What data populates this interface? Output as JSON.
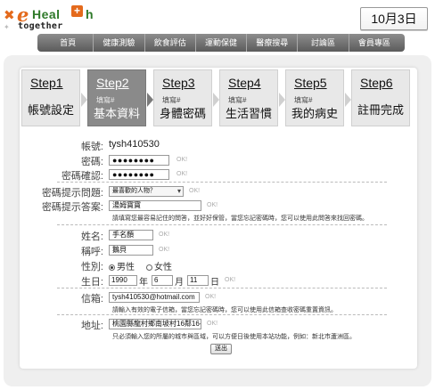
{
  "header": {
    "logo": {
      "e": "e",
      "heal": "Heal",
      "plus": "+",
      "h": "h",
      "together": "together"
    },
    "date": "10月3日"
  },
  "nav": {
    "items": [
      "首頁",
      "健康測驗",
      "飲食評估",
      "運動保健",
      "醫療搜尋",
      "討論區",
      "會員專區"
    ]
  },
  "steps": [
    {
      "title": "Step1",
      "sub": "",
      "name": "帳號設定",
      "active": false
    },
    {
      "title": "Step2",
      "sub": "填寫#",
      "name": "基本資料",
      "active": true
    },
    {
      "title": "Step3",
      "sub": "填寫#",
      "name": "身體密碼",
      "active": false
    },
    {
      "title": "Step4",
      "sub": "填寫#",
      "name": "生活習慣",
      "active": false
    },
    {
      "title": "Step5",
      "sub": "填寫#",
      "name": "我的病史",
      "active": false
    },
    {
      "title": "Step6",
      "sub": "",
      "name": "註冊完成",
      "active": false
    }
  ],
  "form": {
    "account_label": "帳號:",
    "account_value": "tysh410530",
    "password_label": "密碼:",
    "password_value": "●●●●●●●●",
    "password_confirm_label": "密碼確認:",
    "password_confirm_value": "●●●●●●●●",
    "question_label": "密碼提示問題:",
    "question_value": "最喜歡的人物？",
    "answer_label": "密碼提示答案:",
    "answer_value": "湯姆寶寶",
    "answer_hint": "請填寫您最容易記住的問答，並好好保管，當您忘記密碼時，您可以使用此問答來找回密碼。",
    "name_label": "姓名:",
    "name_value": "手名顏",
    "nickname_label": "稱呼:",
    "nickname_value": "鵝貝",
    "gender_label": "性別:",
    "gender_male": "男性",
    "gender_female": "女性",
    "birthday_label": "生日:",
    "birth_year": "1990",
    "birth_year_unit": "年",
    "birth_month": "6",
    "birth_month_unit": "月",
    "birth_day": "11",
    "birth_day_unit": "日",
    "email_label": "信箱:",
    "email_value": "tysh410530@hotmail.com",
    "email_hint": "請輸入有效的電子信箱，當您忘記密碼時，您可以使用此信箱查收密碼重置資訊。",
    "address_label": "地址:",
    "address_value": "桃園縣龍村鄉南坡村16鄰16-1號",
    "address_hint": "只必須輸入您的所屬的城市與區域，可以方便日後使用本站功能，例如：新北市蘆洲區。",
    "ok_text": "OK!",
    "submit_label": "送出"
  }
}
